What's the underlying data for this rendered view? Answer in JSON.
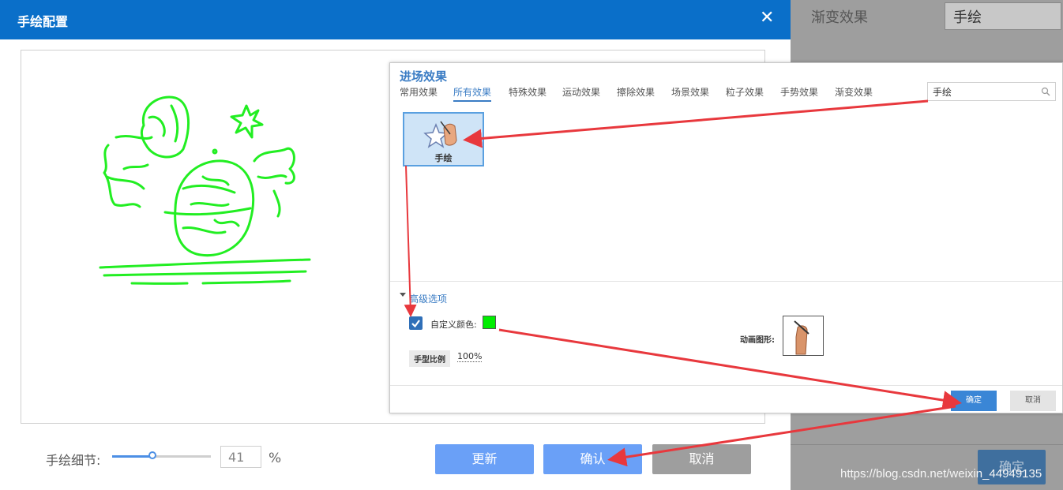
{
  "background": {
    "label": "渐变效果",
    "field_value": "手绘",
    "confirm_label": "确定"
  },
  "dialog": {
    "title": "手绘配置",
    "close_icon": "close-icon",
    "detail_label": "手绘细节:",
    "detail_value": "41",
    "detail_fraction": 0.41,
    "detail_unit": "%",
    "update_label": "更新",
    "confirm_label": "确认",
    "cancel_label": "取消"
  },
  "panel": {
    "title": "进场效果",
    "tabs": [
      "常用效果",
      "所有效果",
      "特殊效果",
      "运动效果",
      "擦除效果",
      "场景效果",
      "粒子效果",
      "手势效果",
      "渐变效果"
    ],
    "active_tab": 1,
    "search_value": "手绘",
    "effect_label": "手绘",
    "advanced_label": "高级选项",
    "custom_color_label": "自定义颜色:",
    "custom_color": "#00ee00",
    "hand_ratio_label": "手型比例",
    "hand_ratio_value": "100%",
    "anim_label": "动画图形:",
    "ok_label": "确定",
    "cancel_label": "取消"
  },
  "colors": {
    "header": "#0a6fc9",
    "accent": "#6aa0f7",
    "sketch": "#22ee22",
    "arrow": "#e8383d"
  },
  "watermark": "https://blog.csdn.net/weixin_44949135"
}
